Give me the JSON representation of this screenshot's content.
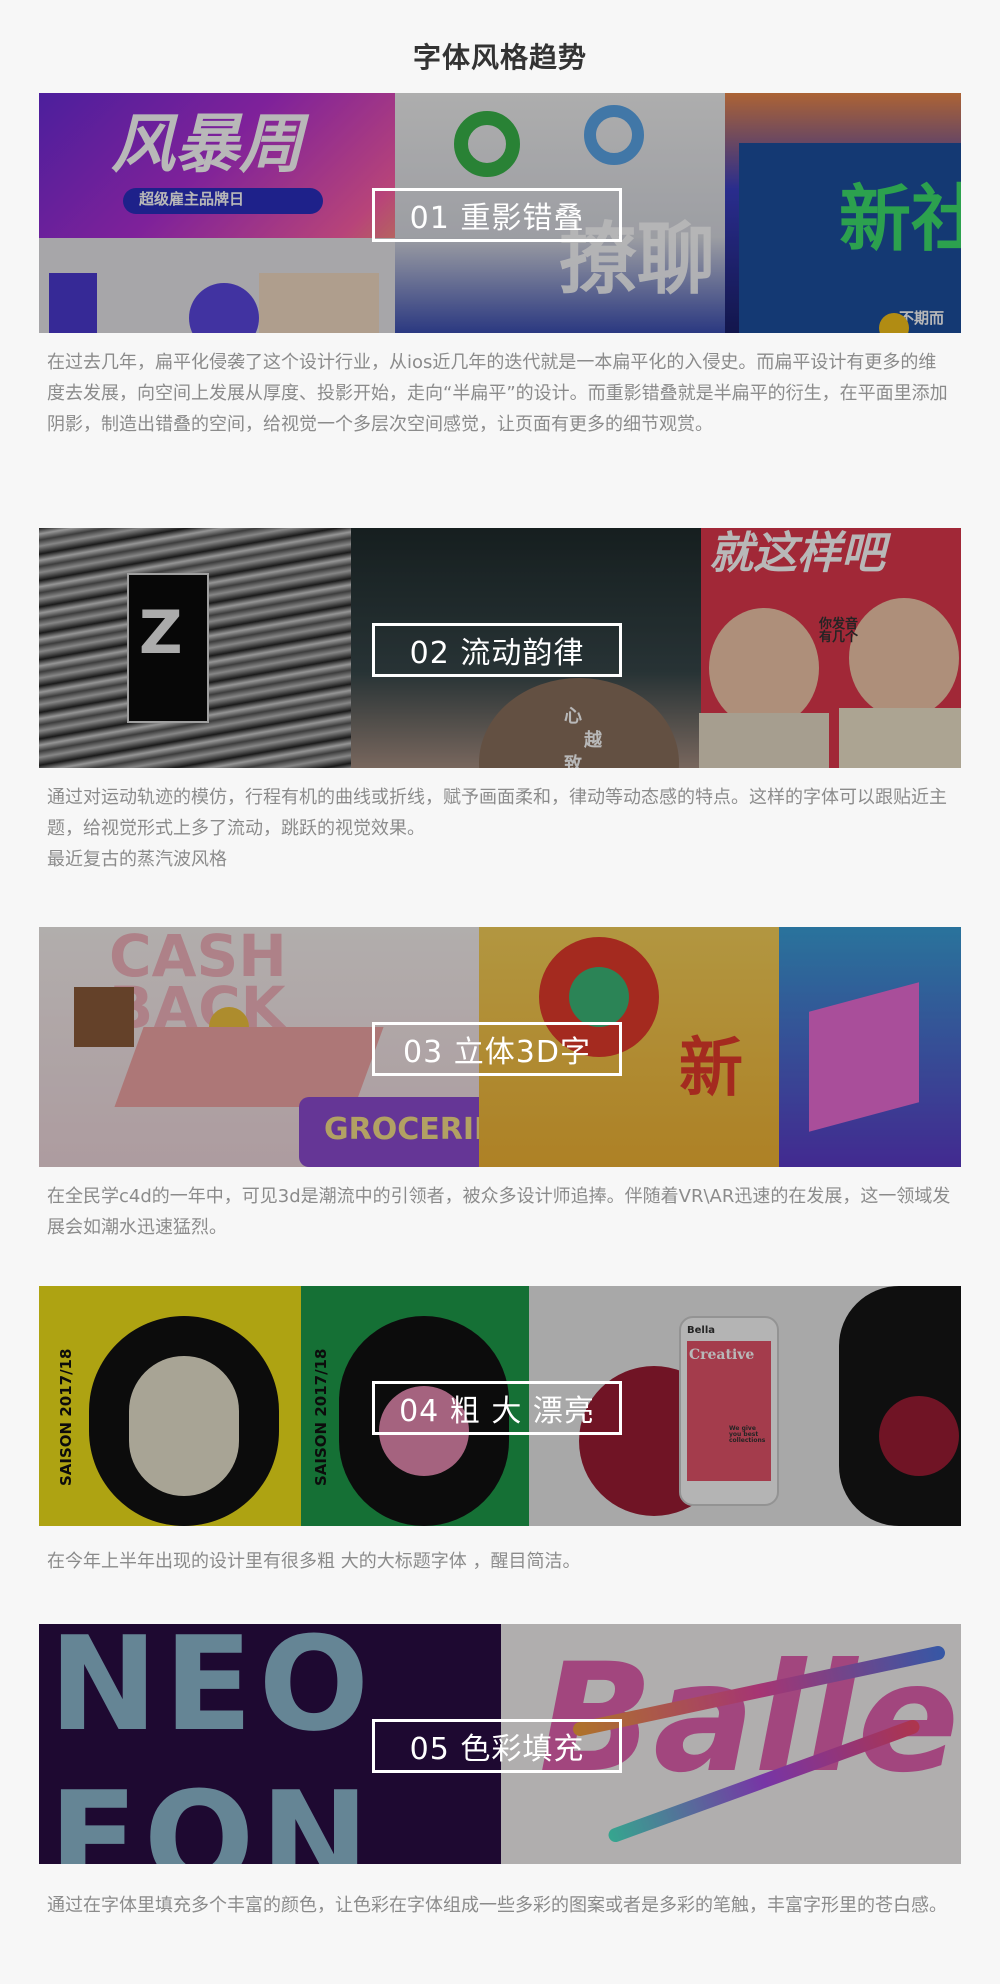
{
  "page": {
    "title": "字体风格趋势"
  },
  "sections": [
    {
      "label": "01 重影错叠",
      "paragraphs": [
        "在过去几年，扁平化侵袭了这个设计行业，从ios近几年的迭代就是一本扁平化的入侵史。而扁平设计有更多的维度去发展，向空间上发展从厚度、投影开始，走向“半扁平”的设计。而重影错叠就是半扁平的衍生，在平面里添加阴影，制造出错叠的空间，给视觉一个多层次空间感觉，让页面有更多的细节观赏。"
      ],
      "art": {
        "text_a": "风暴周",
        "text_b": "超级雇主品牌日",
        "text_c": "新社",
        "text_d": "不期而",
        "text_e": "撩聊"
      }
    },
    {
      "label": "02 流动韵律",
      "paragraphs": [
        "通过对运动轨迹的模仿，行程有机的曲线或折线，赋予画面柔和，律动等动态感的特点。这样的字体可以跟贴近主题，给视觉形式上多了流动，跳跃的视觉效果。",
        "最近复古的蒸汽波风格"
      ],
      "art": {
        "text_a": "就这样吧",
        "text_b": "你发音有几个",
        "text_c": "心",
        "text_d": "越",
        "text_e": "致"
      }
    },
    {
      "label": "03 立体3D字",
      "paragraphs": [
        "在全民学c4d的一年中，可见3d是潮流中的引领者，被众多设计师追捧。伴随着VR\\AR迅速的在发展，这一领域发展会如潮水迅速猛烈。"
      ],
      "art": {
        "text_a": "CASH",
        "text_b": "BACK",
        "text_c": "GROCERIES",
        "text_d": "新"
      }
    },
    {
      "label": "04 粗 大 漂亮",
      "paragraphs": [
        "在今年上半年出现的设计里有很多粗 大的大标题字体 ，醒目简洁。"
      ],
      "art": {
        "text_a": "SAISON 2017/18",
        "text_b": "SAISON 2017/18",
        "text_c": "Bella",
        "text_d": "Creative",
        "text_e": "We give you best collections"
      }
    },
    {
      "label": "05 色彩填充",
      "paragraphs": [
        "通过在字体里填充多个丰富的颜色，让色彩在字体组成一些多彩的图案或者是多彩的笔触，丰富字形里的苍白感。"
      ],
      "art": {
        "text_a": "NEO",
        "text_b": "FON",
        "text_c": "Balle"
      }
    }
  ]
}
